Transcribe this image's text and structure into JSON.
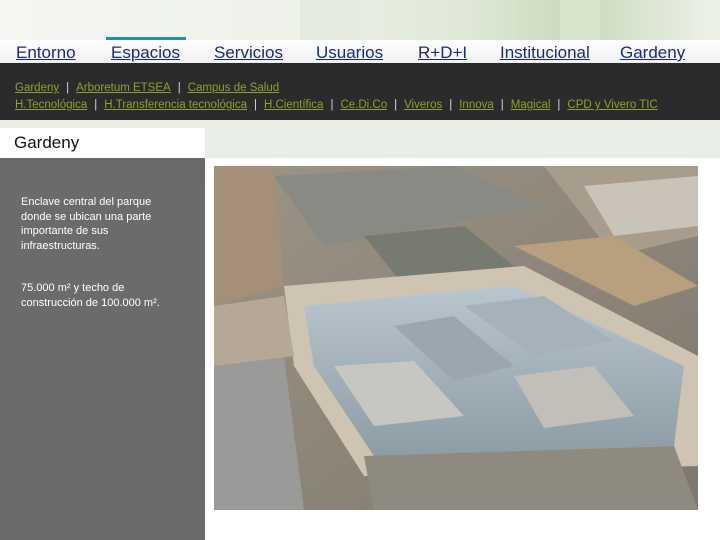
{
  "nav": {
    "items": [
      {
        "label": "Entorno"
      },
      {
        "label": "Espacios"
      },
      {
        "label": "Servicios"
      },
      {
        "label": "Usuarios"
      },
      {
        "label": "R+D+I"
      },
      {
        "label": "Institucional"
      },
      {
        "label": "Gardeny"
      }
    ],
    "active": "Espacios"
  },
  "subnav": {
    "line1": [
      {
        "label": "Gardeny"
      },
      {
        "label": "Arboretum ETSEA"
      },
      {
        "label": "Campus de Salud"
      }
    ],
    "line2": [
      {
        "label": "H.Tecnológica"
      },
      {
        "label": "H.Transferencia tecnológica"
      },
      {
        "label": "H.Científica"
      },
      {
        "label": "Ce.Di.Co"
      },
      {
        "label": "Viveros"
      },
      {
        "label": "Innova"
      },
      {
        "label": "Magical"
      },
      {
        "label": "CPD y Vivero TIC"
      }
    ],
    "separator": "|"
  },
  "page": {
    "title": "Gardeny",
    "paragraphs": [
      "Enclave central del parque donde se ubican una parte importante de sus infraestructuras.",
      "75.000 m² y techo de construcción de 100.000 m²."
    ]
  },
  "colors": {
    "nav_link": "#1a2a7a",
    "subnav_bg": "#2b2b2b",
    "subnav_link": "#8aa32c",
    "active_bar": "#1f8fae",
    "side_panel": "#6b6b6b"
  }
}
